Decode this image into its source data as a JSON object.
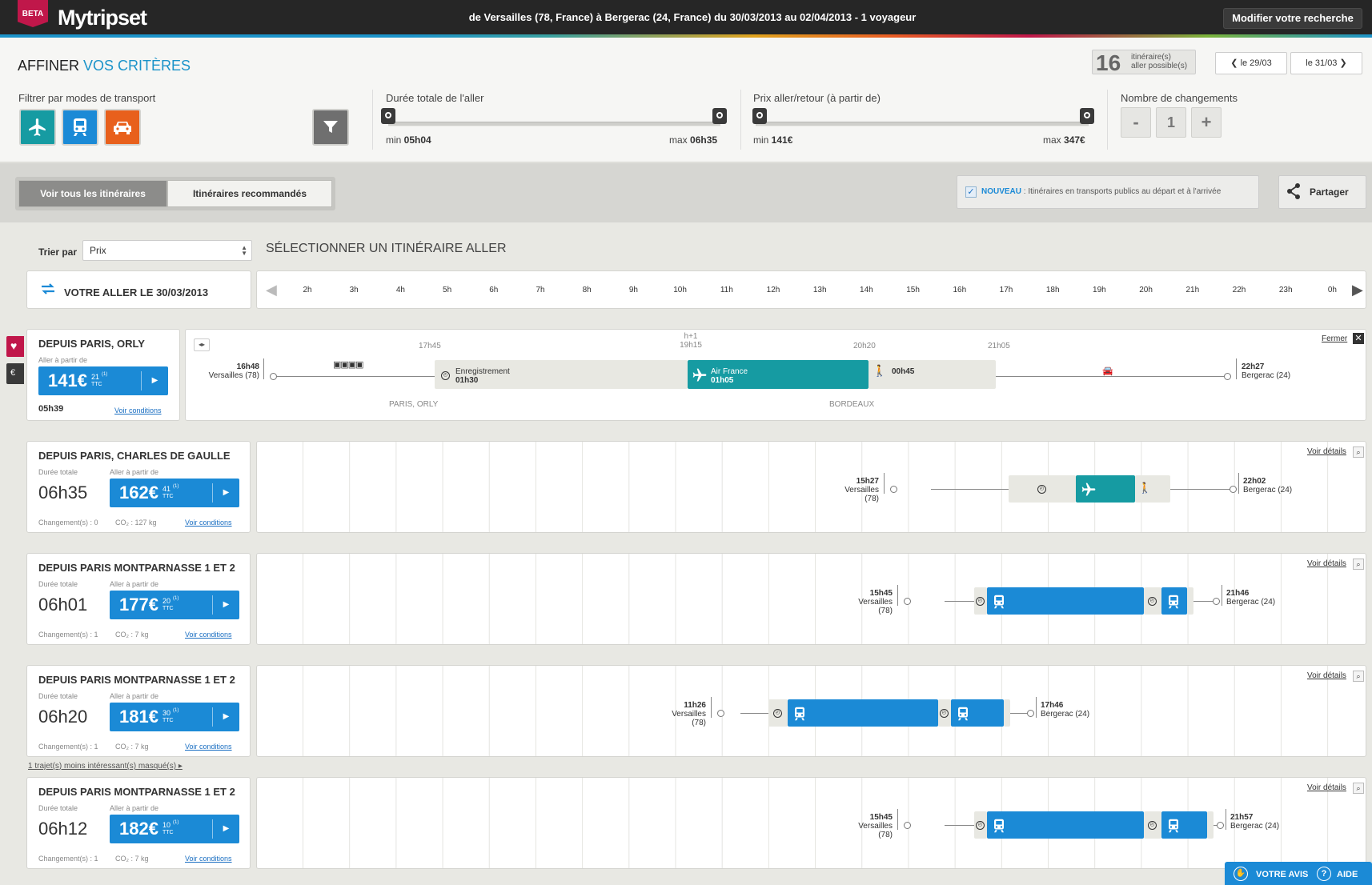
{
  "header": {
    "beta": "BETA",
    "logo": "Mytripset",
    "route": "de Versailles (78, France) à Bergerac (24, France) du 30/03/2013 au 02/04/2013 - 1 voyageur",
    "modify_label": "Modifier votre recherche"
  },
  "filters": {
    "title_a": "AFFINER ",
    "title_b": "VOS CRITÈRES",
    "count": "16",
    "count_label_1": "itinéraire(s)",
    "count_label_2": "aller possible(s)",
    "prev_date": "le 29/03",
    "next_date": "le 31/03",
    "modes_label": "Filtrer par modes de transport",
    "duration_label": "Durée totale de l'aller",
    "duration_min_lbl": "min ",
    "duration_min": "05h04",
    "duration_max_lbl": "max ",
    "duration_max": "06h35",
    "price_label": "Prix aller/retour (à partir de)",
    "price_min_lbl": "min ",
    "price_min": "141€",
    "price_max_lbl": "max ",
    "price_max": "347€",
    "changes_label": "Nombre de changements",
    "changes_minus": "-",
    "changes_value": "1",
    "changes_plus": "+"
  },
  "tabs": {
    "all": "Voir tous les itinéraires",
    "recommended": "Itinéraires recommandés",
    "nouveau": "NOUVEAU",
    "nouveau_text": " : Itinéraires en transports publics au départ et à l'arrivée",
    "share": "Partager"
  },
  "sort": {
    "label": "Trier par",
    "value": "Prix",
    "title": "SÉLECTIONNER UN ITINÉRAIRE ALLER"
  },
  "timeline": {
    "aller_label": "VOTRE ALLER LE 30/03/2013",
    "hours": [
      "2h",
      "3h",
      "4h",
      "5h",
      "6h",
      "7h",
      "8h",
      "9h",
      "10h",
      "11h",
      "12h",
      "13h",
      "14h",
      "15h",
      "16h",
      "17h",
      "18h",
      "19h",
      "20h",
      "21h",
      "22h",
      "23h",
      "0h"
    ]
  },
  "expanded": {
    "title": "DEPUIS PARIS, ORLY",
    "from_label": "Aller à partir de",
    "price": "141€",
    "cents": "21",
    "tax": "(1)",
    "ttc": "TTC",
    "duration": "05h39",
    "conditions": "Voir conditions",
    "close": "Fermer",
    "dep_time": "16h48",
    "dep_place": "Versailles (78)",
    "t1": "17h45",
    "hplus": "h+1",
    "t2": "19h15",
    "t3": "20h20",
    "t4": "21h05",
    "check_label": "Enregistrement",
    "check_time": "01h30",
    "flight_label": "Air France",
    "flight_time": "01h05",
    "walk_time": "00h45",
    "stop1": "PARIS, ORLY",
    "stop2": "BORDEAUX",
    "arr_time": "22h27",
    "arr_place": "Bergerac (24)"
  },
  "results": [
    {
      "title": "DEPUIS PARIS, CHARLES DE GAULLE",
      "dur_label": "Durée totale",
      "from_label": "Aller à partir de",
      "duration": "06h35",
      "price": "162€",
      "cents": "41",
      "tax": "(1)",
      "ttc": "TTC",
      "changes": "Changement(s) : 0",
      "co2": "CO₂ : 127 kg",
      "conditions": "Voir conditions",
      "details": "Voir détails",
      "dep_time": "15h27",
      "dep_place": "Versailles (78)",
      "arr_time": "22h02",
      "arr_place": "Bergerac (24)"
    },
    {
      "title": "DEPUIS PARIS MONTPARNASSE 1 ET 2",
      "dur_label": "Durée totale",
      "from_label": "Aller à partir de",
      "duration": "06h01",
      "price": "177€",
      "cents": "20",
      "tax": "(1)",
      "ttc": "TTC",
      "changes": "Changement(s) : 1",
      "co2": "CO₂ : 7 kg",
      "conditions": "Voir conditions",
      "details": "Voir détails",
      "dep_time": "15h45",
      "dep_place": "Versailles (78)",
      "arr_time": "21h46",
      "arr_place": "Bergerac (24)"
    },
    {
      "title": "DEPUIS PARIS MONTPARNASSE 1 ET 2",
      "dur_label": "Durée totale",
      "from_label": "Aller à partir de",
      "duration": "06h20",
      "price": "181€",
      "cents": "30",
      "tax": "(1)",
      "ttc": "TTC",
      "changes": "Changement(s) : 1",
      "co2": "CO₂ : 7 kg",
      "conditions": "Voir conditions",
      "details": "Voir détails",
      "dep_time": "11h26",
      "dep_place": "Versailles (78)",
      "arr_time": "17h46",
      "arr_place": "Bergerac (24)"
    },
    {
      "title": "DEPUIS PARIS MONTPARNASSE 1 ET 2",
      "dur_label": "Durée totale",
      "from_label": "Aller à partir de",
      "duration": "06h12",
      "price": "182€",
      "cents": "10",
      "tax": "(1)",
      "ttc": "TTC",
      "changes": "Changement(s) : 1",
      "co2": "CO₂ : 7 kg",
      "conditions": "Voir conditions",
      "details": "Voir détails",
      "dep_time": "15h45",
      "dep_place": "Versailles (78)",
      "arr_time": "21h57",
      "arr_place": "Bergerac (24)"
    }
  ],
  "hidden_note": "1 trajet(s) moins intéressant(s) masqué(s) ▸",
  "footer": {
    "avis": "VOTRE AVIS",
    "aide": "AIDE"
  }
}
